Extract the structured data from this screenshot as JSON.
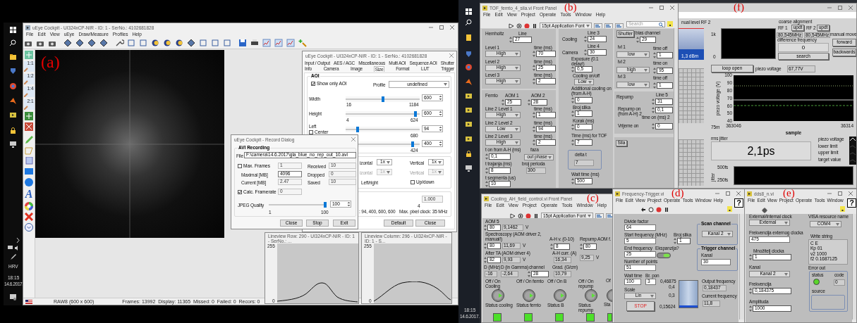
{
  "figure_labels": [
    "(a)",
    "(b)",
    "(c)",
    "(d)",
    "(e)",
    "(f)"
  ],
  "left_screen": {
    "taskbar": {
      "language": "HRV",
      "time": "18:15",
      "date": "14.6.2017."
    },
    "camera_window": {
      "title": "uEye Cockpit - UI324xCP-NIR - ID: 1 - SerNo.: 4102681828",
      "menu": [
        "File",
        "Edit",
        "View",
        "uEye",
        "Draw/Measure",
        "Profiles",
        "Help"
      ],
      "zoom_tools": [
        "1:1",
        "1:2",
        "1:4",
        "2:1"
      ],
      "text_tool": "A",
      "status_bar": [
        "RAW8 (600 x 600)",
        "Frames: 13992  Display: 11365  Missed: 0  Failed: 0  Recors: 0"
      ]
    },
    "settings_dialog": {
      "title": "uEye Cockpit - UI324xCP-NIR - ID: 1 - SerNo.: 4102681828",
      "tab_rows": [
        [
          {
            "label": "Input / Output",
            "selected": false
          },
          {
            "label": "AES / AGC",
            "selected": false
          },
          {
            "label": "Miscellaneous",
            "selected": false
          },
          {
            "label": "Multi AOI",
            "selected": false
          },
          {
            "label": "Sequence AOI",
            "selected": false
          },
          {
            "label": "Shutter",
            "selected": false
          }
        ],
        [
          {
            "label": "Info",
            "selected": false
          },
          {
            "label": "Camera",
            "selected": false
          },
          {
            "label": "Image",
            "selected": false
          },
          {
            "label": "Size",
            "selected": true
          },
          {
            "label": "Format",
            "selected": false
          },
          {
            "label": "LUT",
            "selected": false
          },
          {
            "label": "Trigger",
            "selected": false
          }
        ]
      ],
      "controls": [
        {
          "kind": "group",
          "title": "AOI"
        },
        {
          "kind": "checkbox",
          "text": "Show only AOI",
          "checked": true
        },
        {
          "kind": "label",
          "text": "Profile"
        },
        {
          "kind": "dropdown",
          "value": "undefined"
        },
        {
          "kind": "label",
          "text": "Width"
        },
        {
          "kind": "slider",
          "level": 0.5
        },
        {
          "kind": "spin",
          "value": "600"
        },
        {
          "kind": "label",
          "text": "16"
        },
        {
          "kind": "label",
          "text": "1184"
        },
        {
          "kind": "label",
          "text": "Height"
        },
        {
          "kind": "slider",
          "level": 0.96
        },
        {
          "kind": "spin",
          "value": "600"
        },
        {
          "kind": "label",
          "text": "4"
        },
        {
          "kind": "label",
          "text": "624"
        },
        {
          "kind": "label",
          "text": "Left"
        },
        {
          "kind": "slider",
          "level": 0.15
        },
        {
          "kind": "spin",
          "value": "94"
        },
        {
          "kind": "checkbox",
          "text": "Center",
          "checked": false
        },
        {
          "kind": "label",
          "text": "680"
        },
        {
          "kind": "slider",
          "level": 0.92
        },
        {
          "kind": "spin",
          "value": "400"
        },
        {
          "kind": "label",
          "text": "424"
        },
        {
          "kind": "group"
        },
        {
          "kind": "label",
          "text": "izontal"
        },
        {
          "kind": "dropdown",
          "value": "1x"
        },
        {
          "kind": "label",
          "text": "Vertical"
        },
        {
          "kind": "dropdown",
          "value": "1x"
        },
        {
          "kind": "dimtext",
          "text": "izontal"
        },
        {
          "kind": "dimdropdown",
          "value": "1x"
        },
        {
          "kind": "dimtext",
          "text": "Vertical"
        },
        {
          "kind": "dimdropdown",
          "value": "1x"
        },
        {
          "kind": "label",
          "text": "Left/right"
        },
        {
          "kind": "checkbox",
          "text": "Up/down",
          "checked": false
        },
        {
          "kind": "group"
        },
        {
          "kind": "dimfield",
          "value": "1.000"
        },
        {
          "kind": "label",
          "text": "4"
        },
        {
          "kind": "label",
          "text": ": 94, 400, 600, 600"
        },
        {
          "kind": "label",
          "text": "Max. pixel clock: 35 MHz"
        },
        {
          "kind": "button",
          "text": "Default"
        },
        {
          "kind": "button",
          "text": "Close"
        }
      ]
    },
    "record_dialog": {
      "title": "uEye Cockpit - Record Dialog",
      "controls": [
        {
          "kind": "group",
          "title": "AVI Recording"
        },
        {
          "kind": "label",
          "text": "File"
        },
        {
          "kind": "field",
          "value": "F:\\camera\\14.6.2017\\gla_blue_no_rep_out_10.avi"
        },
        {
          "kind": "checkbox",
          "text": "Max. Frames",
          "checked": false
        },
        {
          "kind": "dimfield",
          "value": "1"
        },
        {
          "kind": "label",
          "text": "Maximal [MB]"
        },
        {
          "kind": "field",
          "value": "4096"
        },
        {
          "kind": "label",
          "text": "Current [MB]"
        },
        {
          "kind": "dimfield",
          "value": "2.47"
        },
        {
          "kind": "checkbox",
          "text": "Calc. Framerate",
          "checked": true
        },
        {
          "kind": "dimfield",
          "value": "0"
        },
        {
          "kind": "label",
          "text": "Received"
        },
        {
          "kind": "dimfield",
          "value": "10"
        },
        {
          "kind": "label",
          "text": "Dropped"
        },
        {
          "kind": "dimfield",
          "value": "0"
        },
        {
          "kind": "label",
          "text": "Saved"
        },
        {
          "kind": "dimfield",
          "value": "10"
        },
        {
          "kind": "label",
          "text": "JPEG Quality"
        },
        {
          "kind": "slider",
          "level": 1
        },
        {
          "kind": "spin",
          "value": "100"
        },
        {
          "kind": "label",
          "text": "1"
        },
        {
          "kind": "label",
          "text": "100"
        },
        {
          "kind": "button",
          "text": "Close"
        },
        {
          "kind": "button",
          "text": "Stop"
        },
        {
          "kind": "button",
          "text": "Exit"
        }
      ]
    },
    "lineview_windows": [
      {
        "title": "Lineview Row: 290 - UI324xCP-NIR - ID: 1 - SerNo.: ...",
        "y_max": "255",
        "y_min": "0"
      },
      {
        "title": "Lineview Column: 296 - UI324xCP-NIR - ID: 1 - S...",
        "y_max": "255",
        "y_min": "0"
      }
    ]
  },
  "right_screen": {
    "taskbar": {
      "time": "18:15",
      "date": "14.6.2017."
    },
    "tof_window": {
      "title": "TOF_femto_4_sila.vi Front Panel",
      "menu": [
        "File",
        "Edit",
        "View",
        "Project",
        "Operate",
        "Tools",
        "Window",
        "Help"
      ],
      "font_menu": "15pt Application Font",
      "search_placeholder": "Search",
      "controls": [
        {
          "kind": "label",
          "text": "Hemholtz"
        },
        {
          "kind": "label",
          "text": "Line"
        },
        {
          "kind": "numeric",
          "value": "27"
        },
        {
          "kind": "label",
          "text": "Level 1"
        },
        {
          "kind": "label",
          "text": "time (ms)"
        },
        {
          "kind": "dropdown",
          "value": "High"
        },
        {
          "kind": "numeric",
          "value": "70"
        },
        {
          "kind": "label",
          "text": "Level 2"
        },
        {
          "kind": "label",
          "text": "time (ms)"
        },
        {
          "kind": "dropdown",
          "value": "High"
        },
        {
          "kind": "numeric",
          "value": "25"
        },
        {
          "kind": "label",
          "text": "Level 3"
        },
        {
          "kind": "label",
          "text": "time (ms)"
        },
        {
          "kind": "dropdown",
          "value": "High"
        },
        {
          "kind": "numeric",
          "value": "2"
        },
        {
          "kind": "label",
          "text": "Femto"
        },
        {
          "kind": "label",
          "text": "AOM 1"
        },
        {
          "kind": "label",
          "text": "AOM 2"
        },
        {
          "kind": "numeric",
          "value": "25"
        },
        {
          "kind": "numeric",
          "value": "28"
        },
        {
          "kind": "label",
          "text": "Line 2 Level 1"
        },
        {
          "kind": "label",
          "text": "time (ms)"
        },
        {
          "kind": "dropdown",
          "value": "High"
        },
        {
          "kind": "numeric",
          "value": "1"
        },
        {
          "kind": "label",
          "text": "Line 2 Level 2"
        },
        {
          "kind": "label",
          "text": "time (ms)"
        },
        {
          "kind": "dropdown",
          "value": "Low"
        },
        {
          "kind": "numeric",
          "value": "94"
        },
        {
          "kind": "label",
          "text": "Line 2 Level 3"
        },
        {
          "kind": "label",
          "text": "time (ms)"
        },
        {
          "kind": "dropdown",
          "value": "High"
        },
        {
          "kind": "numeric",
          "value": "2"
        },
        {
          "kind": "label",
          "text": "t on from A-H (ms)"
        },
        {
          "kind": "label",
          "text": "faza"
        },
        {
          "kind": "numeric",
          "value": "0,1"
        },
        {
          "kind": "dropdown",
          "value": "out phase"
        },
        {
          "kind": "label",
          "text": "t trajanja (ms)"
        },
        {
          "kind": "label",
          "text": "broj perioda"
        },
        {
          "kind": "indicator",
          "value": "300"
        },
        {
          "kind": "numeric",
          "value": "8"
        },
        {
          "kind": "label",
          "text": "t segmenta (us)"
        },
        {
          "kind": "numeric",
          "value": "10"
        },
        {
          "kind": "label",
          "text": "Line 3"
        },
        {
          "kind": "label",
          "text": "Cooling"
        },
        {
          "kind": "numeric",
          "value": "24"
        },
        {
          "kind": "label",
          "text": "Line 4"
        },
        {
          "kind": "label",
          "text": "Camera"
        },
        {
          "kind": "numeric",
          "value": "30"
        },
        {
          "kind": "label",
          "text": "Exposure (0.1 delay!)"
        },
        {
          "kind": "numeric",
          "value": "0,5"
        },
        {
          "kind": "label",
          "text": "Cooling on/off"
        },
        {
          "kind": "dropdown",
          "value": "Low"
        },
        {
          "kind": "label",
          "text": "Additional cooling on (from A-H)"
        },
        {
          "kind": "numeric",
          "value": "0"
        },
        {
          "kind": "label",
          "text": "Broj slika"
        },
        {
          "kind": "numeric",
          "value": "1"
        },
        {
          "kind": "label",
          "text": "Korak (ms)"
        },
        {
          "kind": "numeric",
          "value": "0"
        },
        {
          "kind": "label",
          "text": "Time (ms) for TOF"
        },
        {
          "kind": "numeric",
          "value": "7"
        },
        {
          "kind": "group"
        },
        {
          "kind": "label",
          "text": "delta t"
        },
        {
          "kind": "indicator",
          "value": "7"
        },
        {
          "kind": "label",
          "text": "Wait time (ms)"
        },
        {
          "kind": "numeric",
          "value": "500"
        },
        {
          "kind": "button",
          "text": "Shutter"
        },
        {
          "kind": "label",
          "text": "bias channel"
        },
        {
          "kind": "numeric",
          "value": "29"
        },
        {
          "kind": "label",
          "text": "lvl 1"
        },
        {
          "kind": "label",
          "text": "time off"
        },
        {
          "kind": "dropdown",
          "value": "low"
        },
        {
          "kind": "numeric",
          "value": "1"
        },
        {
          "kind": "label",
          "text": "lvl 2"
        },
        {
          "kind": "label",
          "text": "time on"
        },
        {
          "kind": "dropdown",
          "value": "high"
        },
        {
          "kind": "numeric",
          "value": "95"
        },
        {
          "kind": "label",
          "text": "lvl 3"
        },
        {
          "kind": "label",
          "text": "time off"
        },
        {
          "kind": "dropdown",
          "value": "low"
        },
        {
          "kind": "numeric",
          "value": "1"
        },
        {
          "kind": "label",
          "text": "Repump"
        },
        {
          "kind": "label",
          "text": "Line 5"
        },
        {
          "kind": "numeric",
          "value": "31"
        },
        {
          "kind": "label",
          "text": "Repump on (from A-H) 2"
        },
        {
          "kind": "numeric",
          "value": "0,1"
        },
        {
          "kind": "label",
          "text": "time on (ms) 2"
        },
        {
          "kind": "label",
          "text": "Vrijeme on"
        },
        {
          "kind": "numeric",
          "value": "0"
        },
        {
          "kind": "button",
          "text": "Sila"
        }
      ]
    },
    "feedback_window": {
      "controls": [
        {
          "kind": "label",
          "text": "nual level RF 2"
        },
        {
          "kind": "meter",
          "level": 0.35,
          "reading": "1,3 dBm"
        },
        {
          "kind": "label",
          "text": "1k"
        },
        {
          "kind": "label",
          "text": "0"
        },
        {
          "kind": "blackplot"
        },
        {
          "kind": "label",
          "text": "coarse alignment"
        },
        {
          "kind": "label",
          "text": "RF 1"
        },
        {
          "kind": "button",
          "text": "updt"
        },
        {
          "kind": "label",
          "text": "RF 2"
        },
        {
          "kind": "button",
          "text": "updt"
        },
        {
          "kind": "indicator",
          "value": "80,545MHz"
        },
        {
          "kind": "indicator",
          "value": "80,545MHz"
        },
        {
          "kind": "label",
          "text": "difference frequency"
        },
        {
          "kind": "bigindicator",
          "value": "0"
        },
        {
          "kind": "button",
          "text": "search"
        },
        {
          "kind": "label",
          "text": "manual move"
        },
        {
          "kind": "button",
          "text": "forward"
        },
        {
          "kind": "button",
          "text": "backwards"
        },
        {
          "kind": "button",
          "text": "loop open"
        },
        {
          "kind": "label",
          "text": "piezo voltage"
        },
        {
          "kind": "indicator",
          "value": "67,77V"
        },
        {
          "kind": "label",
          "text": "75m"
        },
        {
          "kind": "label",
          "text": "rms jitter"
        },
        {
          "kind": "bigindicator",
          "value": "2,1ps"
        },
        {
          "kind": "blackplot"
        },
        {
          "kind": "label",
          "text": "500fs"
        },
        {
          "kind": "label",
          "text": "250fs"
        },
        {
          "kind": "vlabel",
          "text": "jitter"
        }
      ],
      "piezo_chart": {
        "xlabel": "sample",
        "ylabel": "piezo voltage (V)",
        "x_tick_labels": [
          "363046",
          "36314"
        ],
        "y_tick_labels": [
          "100",
          "90",
          "80",
          "70",
          "60",
          "50",
          "40"
        ],
        "legend": [
          "piezo voltage",
          "lower limit",
          "upper limit",
          "target value"
        ]
      }
    },
    "cooling_window": {
      "title": "Cooling_AH_field_control.vi Front Panel",
      "menu": [
        "File",
        "Edit",
        "View",
        "Project",
        "Operate",
        "Tools",
        "Window",
        "Help"
      ],
      "font_menu": "15pt Application Font",
      "controls": [
        {
          "kind": "label",
          "text": "AOM 5"
        },
        {
          "kind": "numeric",
          "value": "80"
        },
        {
          "kind": "indicator",
          "value": "9,1462"
        },
        {
          "kind": "label",
          "text": "V"
        },
        {
          "kind": "label",
          "text": "Spectroscopy (AOM driver 2, manual!)"
        },
        {
          "kind": "numeric",
          "value": "80"
        },
        {
          "kind": "indicator",
          "value": "11,69"
        },
        {
          "kind": "label",
          "text": "V"
        },
        {
          "kind": "label",
          "text": "A-H v. (0-10)"
        },
        {
          "kind": "numeric",
          "value": "8"
        },
        {
          "kind": "label",
          "text": "Repump AOM f."
        },
        {
          "kind": "numeric",
          "value": "80"
        },
        {
          "kind": "label",
          "text": "After TA (AOM driver 4)"
        },
        {
          "kind": "numeric",
          "value": "82"
        },
        {
          "kind": "indicator",
          "value": "9,93"
        },
        {
          "kind": "label",
          "text": "V"
        },
        {
          "kind": "label",
          "text": "A-H curr. (A)"
        },
        {
          "kind": "indicator",
          "value": "16,34"
        },
        {
          "kind": "indicator",
          "value": "9,25"
        },
        {
          "kind": "label",
          "text": "V"
        },
        {
          "kind": "label",
          "text": "D (MHz)"
        },
        {
          "kind": "label",
          "text": "D (in Gamma)"
        },
        {
          "kind": "label",
          "text": "channel"
        },
        {
          "kind": "label",
          "text": "Grad. (G/cm)"
        },
        {
          "kind": "indicator",
          "value": "-16"
        },
        {
          "kind": "indicator",
          "value": "-2,64"
        },
        {
          "kind": "numeric",
          "value": "28"
        },
        {
          "kind": "indicator",
          "value": "10,79"
        },
        {
          "kind": "label",
          "text": "Off / On Cooling"
        },
        {
          "kind": "label",
          "text": "Off / On femto"
        },
        {
          "kind": "label",
          "text": "Off / On B"
        },
        {
          "kind": "label",
          "text": "Off / On repump"
        },
        {
          "kind": "label",
          "text": "Of"
        },
        {
          "kind": "knob",
          "on": true
        },
        {
          "kind": "knob",
          "on": true
        },
        {
          "kind": "knob",
          "on": true
        },
        {
          "kind": "knob",
          "on": true
        },
        {
          "kind": "knobedge"
        },
        {
          "kind": "label",
          "text": "Status cooling"
        },
        {
          "kind": "label",
          "text": "Status femto"
        },
        {
          "kind": "label",
          "text": "Status B"
        },
        {
          "kind": "label",
          "text": "Status repump"
        },
        {
          "kind": "label",
          "text": "Sta"
        },
        {
          "kind": "squareled",
          "on": true
        },
        {
          "kind": "squareled",
          "on": true
        },
        {
          "kind": "squareled",
          "on": true
        },
        {
          "kind": "squareled",
          "on": true
        },
        {
          "kind": "squareled",
          "on": true
        }
      ]
    },
    "trigger_window": {
      "title": "Frequency-Trigger.vi",
      "menu": [
        "File",
        "Edit",
        "View",
        "Project",
        "Operate",
        "Tools",
        "Window",
        "Help"
      ],
      "help": "?",
      "controls": [
        {
          "kind": "label",
          "text": "Divide factor"
        },
        {
          "kind": "field",
          "value": "64"
        },
        {
          "kind": "label",
          "text": "Start frequency (MHz)"
        },
        {
          "kind": "label",
          "text": "Broj slika"
        },
        {
          "kind": "field",
          "value": "5"
        },
        {
          "kind": "numeric",
          "value": "1"
        },
        {
          "kind": "label",
          "text": "End frequency"
        },
        {
          "kind": "field",
          "value": "25"
        },
        {
          "kind": "label",
          "text": "Ekspanzija?"
        },
        {
          "kind": "toggle",
          "on": true
        },
        {
          "kind": "label",
          "text": "Number of points"
        },
        {
          "kind": "field",
          "value": "51"
        },
        {
          "kind": "label",
          "text": "Wait time"
        },
        {
          "kind": "label",
          "text": "Br. pon"
        },
        {
          "kind": "field",
          "value": "100"
        },
        {
          "kind": "field",
          "value": "3"
        },
        {
          "kind": "label",
          "text": "Scale"
        },
        {
          "kind": "dropdown",
          "value": "Lin"
        },
        {
          "kind": "stopbutton",
          "text": "STOP"
        },
        {
          "kind": "group",
          "title": "Scan channel"
        },
        {
          "kind": "dropdown",
          "value": "Kanal 2"
        },
        {
          "kind": "group",
          "title": "Trigger channel"
        },
        {
          "kind": "label",
          "text": "Kanal"
        },
        {
          "kind": "field",
          "value": "30"
        },
        {
          "kind": "label",
          "text": "0,46875"
        },
        {
          "kind": "label",
          "text": "0,4"
        },
        {
          "kind": "label",
          "text": "0,3"
        },
        {
          "kind": "label",
          "text": "0,15624"
        },
        {
          "kind": "tank",
          "level": 0.09
        },
        {
          "kind": "label",
          "text": "Output frequency"
        },
        {
          "kind": "indicator",
          "value": "0,18437"
        },
        {
          "kind": "label",
          "text": "Current frequency"
        },
        {
          "kind": "indicator",
          "value": "11,8"
        }
      ]
    },
    "dds_window": {
      "title": "dds8_n.vi",
      "menu": [
        "File",
        "Edit",
        "View",
        "Project",
        "Operate",
        "Tools",
        "Window"
      ],
      "help": "?",
      "controls": [
        {
          "kind": "label",
          "text": "External/Internal clock"
        },
        {
          "kind": "dropdown",
          "value": "External"
        },
        {
          "kind": "label",
          "text": "Frekvencija externog clocka"
        },
        {
          "kind": "field",
          "value": "475"
        },
        {
          "kind": "label",
          "text": "Množitelj clocka"
        },
        {
          "kind": "numeric",
          "value": "1"
        },
        {
          "kind": "label",
          "text": "Kanal"
        },
        {
          "kind": "dropdown",
          "value": "Kanal 2"
        },
        {
          "kind": "label",
          "text": "Frekvencija"
        },
        {
          "kind": "numeric",
          "value": "0,184375"
        },
        {
          "kind": "label",
          "text": "Amplituda"
        },
        {
          "kind": "numeric",
          "value": "1000"
        },
        {
          "kind": "label",
          "text": "VISA resource name"
        },
        {
          "kind": "dropdown",
          "value": "COM4"
        },
        {
          "kind": "label",
          "text": "Write string"
        },
        {
          "kind": "string",
          "lines": [
            "C E",
            "Kp 01",
            "v2 1000",
            "f2 0.1687125"
          ]
        },
        {
          "kind": "label",
          "text": "Error out"
        },
        {
          "kind": "group"
        },
        {
          "kind": "label",
          "text": "status"
        },
        {
          "kind": "label",
          "text": "code"
        },
        {
          "kind": "led",
          "on": true
        },
        {
          "kind": "indicator",
          "value": "0"
        },
        {
          "kind": "label",
          "text": "source"
        },
        {
          "kind": "group"
        }
      ]
    }
  }
}
